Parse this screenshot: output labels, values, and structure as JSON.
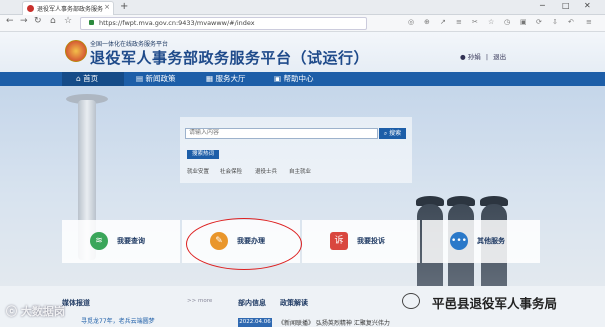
{
  "browser": {
    "tab_title": "退役军人事务部政务服务平台",
    "url": "https://fwpt.mva.gov.cn:9433/mvawww/#/index"
  },
  "site": {
    "subtitle": "全国一体化在线政务服务平台",
    "title": "退役军人事务部政务服务平台（试运行）",
    "user": "孙娟",
    "logout": "退出"
  },
  "nav": [
    {
      "label": "首页",
      "icon": "home-icon"
    },
    {
      "label": "新闻政策",
      "icon": "news-icon"
    },
    {
      "label": "服务大厅",
      "icon": "grid-icon"
    },
    {
      "label": "帮助中心",
      "icon": "help-icon"
    }
  ],
  "search": {
    "placeholder": "请输入内容",
    "button": "搜索",
    "hot_label": "搜索热词",
    "hot_words": [
      "就业安置",
      "社会保险",
      "退役士兵",
      "自主就业"
    ]
  },
  "cards": [
    {
      "label": "我要查询",
      "icon": "layers-icon",
      "color": "#3aa65a"
    },
    {
      "label": "我要办理",
      "icon": "edit-icon",
      "color": "#e9962b"
    },
    {
      "label": "我要投诉",
      "icon": "complaint-icon",
      "color": "#d9473f"
    },
    {
      "label": "其他服务",
      "icon": "more-icon",
      "color": "#2b79c9"
    }
  ],
  "bottom": {
    "media_title": "媒体报道",
    "more": ">> more",
    "media_item": "寻觅龙77年，老兵云端圆梦",
    "dept_title": "部内信息",
    "policy_title": "政策解读",
    "date": "2022.04.06",
    "news_item": "《新闻联播》 弘扬英烈精神 汇聚复兴伟力"
  },
  "watermarks": {
    "left": "大数据岗",
    "right": "平邑县退役军人事务局"
  }
}
